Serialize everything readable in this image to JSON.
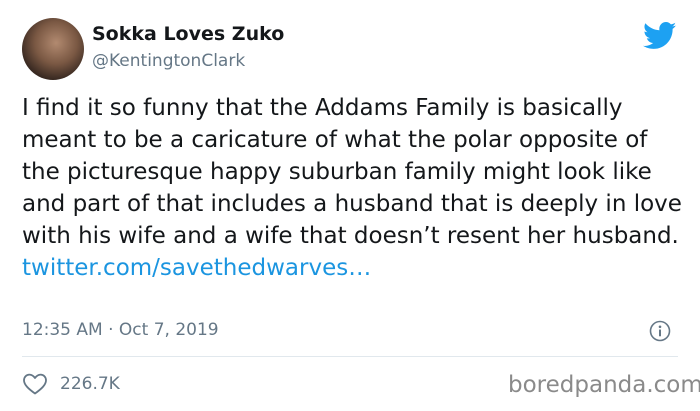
{
  "author": {
    "display_name": "Sokka Loves Zuko",
    "handle": "@KentingtonClark",
    "avatar_icon": "profile-photo"
  },
  "tweet": {
    "text": "I find it so funny that the Addams Family is basically meant to be a caricature of what the polar opposite of the picturesque happy suburban family might look like and part of that includes a husband that is deeply in love with his wife and a wife that doesn’t resent her husband.",
    "link": "twitter.com/savethedwarves…",
    "timestamp": "12:35 AM · Oct 7, 2019"
  },
  "stats": {
    "likes": "226.7K"
  },
  "watermark": "boredpanda.com",
  "colors": {
    "brand": "#1da1f2",
    "link": "#1b95e0",
    "muted": "#657786",
    "divider": "#e1e8ed"
  },
  "icons": [
    "twitter-bird-icon",
    "info-icon",
    "heart-icon"
  ]
}
